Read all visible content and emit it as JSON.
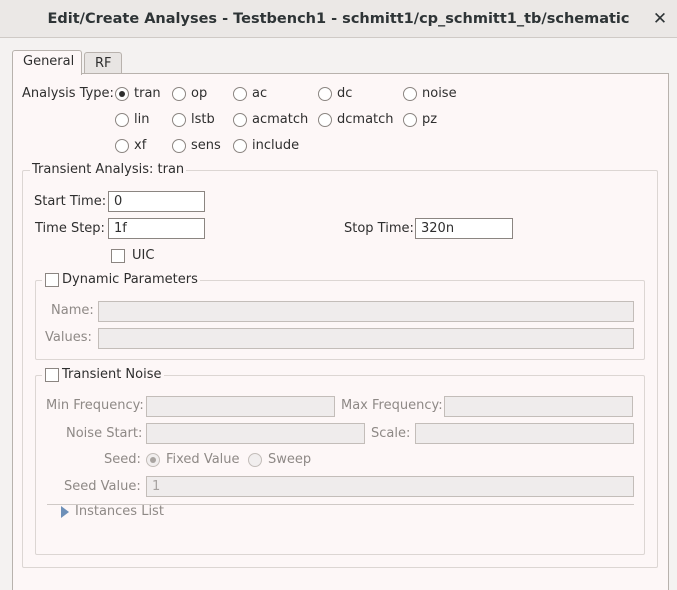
{
  "window": {
    "title": "Edit/Create Analyses - Testbench1 - schmitt1/cp_schmitt1_tb/schematic",
    "close_glyph": "✕"
  },
  "tabs": [
    {
      "label": "General",
      "active": true
    },
    {
      "label": "RF",
      "active": false
    }
  ],
  "analysis_type": {
    "label": "Analysis Type:",
    "selected": "tran",
    "options": [
      "tran",
      "op",
      "ac",
      "dc",
      "noise",
      "lin",
      "lstb",
      "acmatch",
      "dcmatch",
      "pz",
      "xf",
      "sens",
      "include"
    ]
  },
  "transient": {
    "group_title": "Transient Analysis: tran",
    "start_time_label": "Start Time:",
    "start_time_value": "0",
    "time_step_label": "Time Step:",
    "time_step_value": "1f",
    "stop_time_label": "Stop Time:",
    "stop_time_value": "320n",
    "uic_label": "UIC",
    "uic_checked": false
  },
  "dynamic_parameters": {
    "title": "Dynamic Parameters",
    "checked": false,
    "name_label": "Name:",
    "name_value": "",
    "values_label": "Values:",
    "values_value": ""
  },
  "transient_noise": {
    "title": "Transient Noise",
    "checked": false,
    "min_freq_label": "Min Frequency:",
    "min_freq_value": "",
    "max_freq_label": "Max Frequency:",
    "max_freq_value": "",
    "noise_start_label": "Noise Start:",
    "noise_start_value": "",
    "scale_label": "Scale:",
    "scale_value": "",
    "seed_label": "Seed:",
    "seed_fixed_label": "Fixed Value",
    "seed_sweep_label": "Sweep",
    "seed_selected": "Fixed Value",
    "seed_value_label": "Seed Value:",
    "seed_value": "1",
    "instances_list_label": "Instances List"
  }
}
